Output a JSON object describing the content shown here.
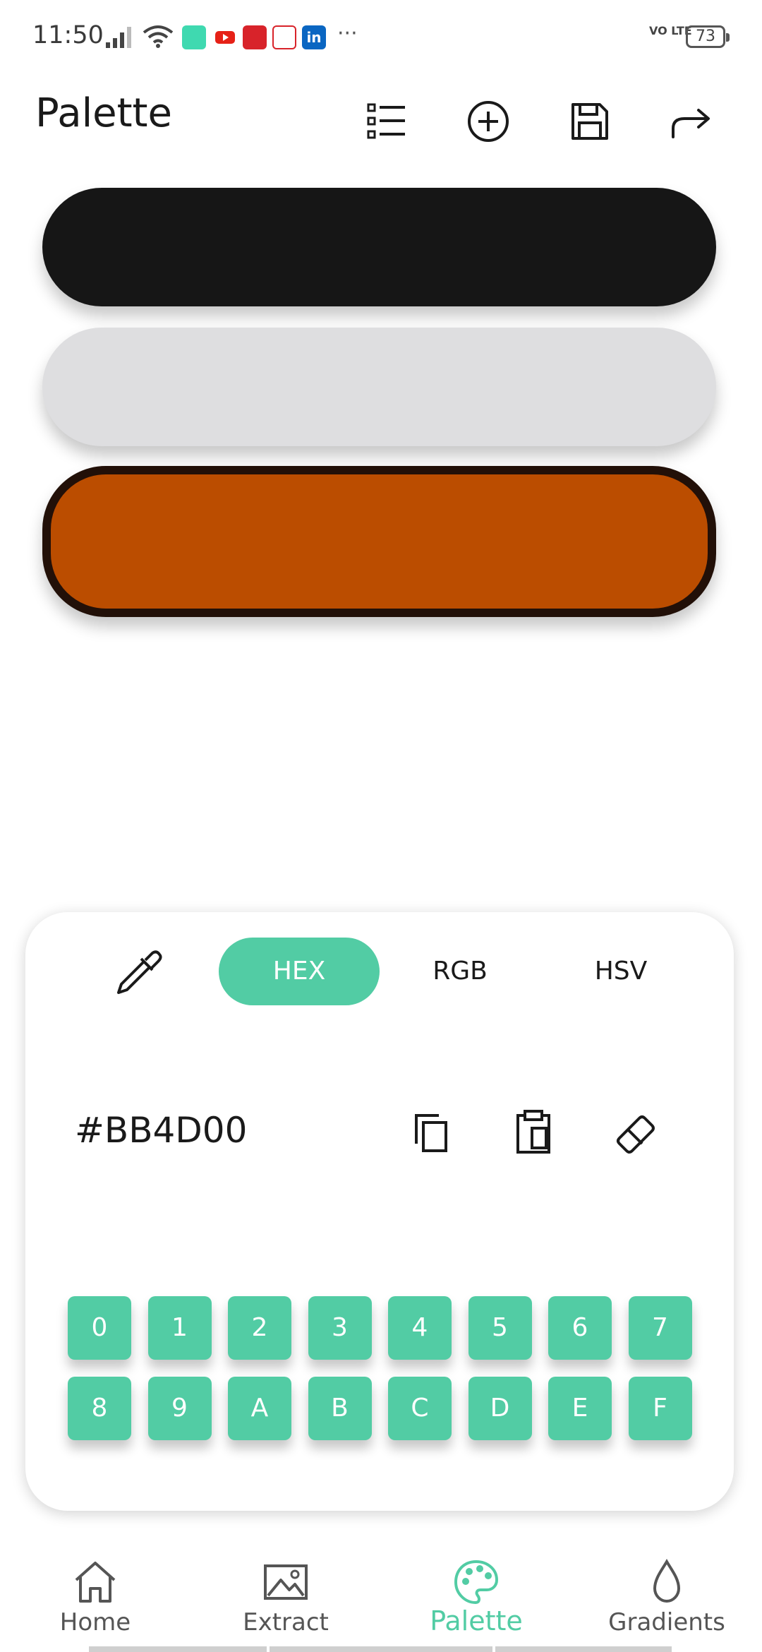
{
  "status_bar": {
    "time": "11:50",
    "network": "VO LTE",
    "battery": "73"
  },
  "app_bar": {
    "title": "Palette",
    "actions": [
      "list-icon",
      "add-circle-icon",
      "save-icon",
      "share-icon"
    ]
  },
  "swatches": [
    {
      "color": "#161616",
      "selected": false
    },
    {
      "color": "#dedee0",
      "selected": false
    },
    {
      "color": "#BB4D00",
      "selected": true
    }
  ],
  "editor": {
    "modes": [
      "HEX",
      "RGB",
      "HSV"
    ],
    "active_mode": "HEX",
    "value": "#BB4D00",
    "keys": [
      "0",
      "1",
      "2",
      "3",
      "4",
      "5",
      "6",
      "7",
      "8",
      "9",
      "A",
      "B",
      "C",
      "D",
      "E",
      "F"
    ],
    "accent": "#52cca4"
  },
  "bottom_nav": {
    "items": [
      {
        "label": "Home",
        "icon": "home-icon"
      },
      {
        "label": "Extract",
        "icon": "image-icon"
      },
      {
        "label": "Palette",
        "icon": "palette-icon"
      },
      {
        "label": "Gradients",
        "icon": "drop-icon"
      }
    ],
    "active": "Palette"
  }
}
